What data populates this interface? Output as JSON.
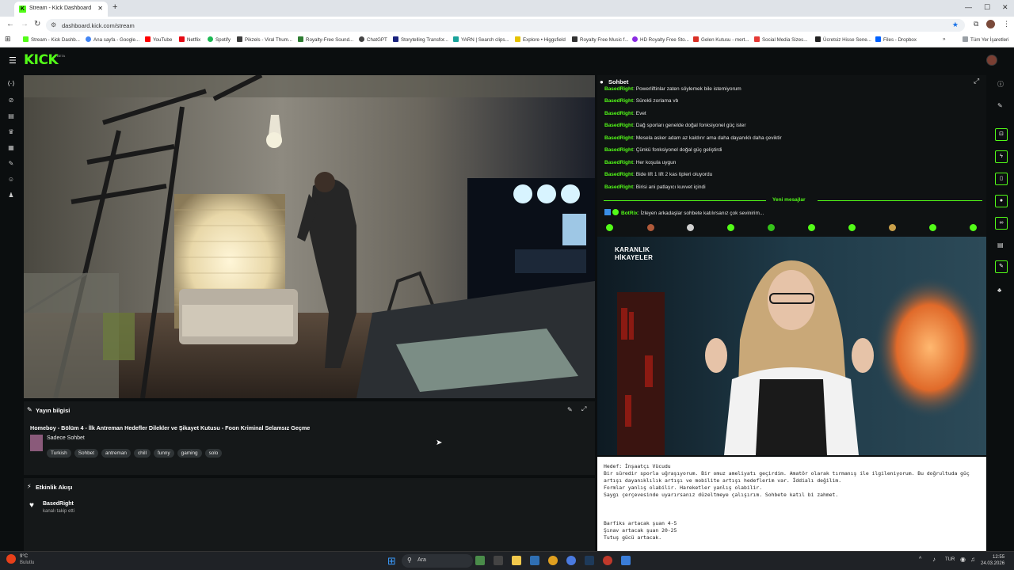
{
  "browser": {
    "tab_title": "Stream - Kick Dashboard",
    "url": "dashboard.kick.com/stream",
    "bookmarks": [
      "Stream - Kick Dashb...",
      "Ana sayfa - Google...",
      "YouTube",
      "Netflix",
      "Spotify",
      "Pikzels - Viral Thum...",
      "Royalty-Free Sound...",
      "ChatGPT",
      "Storytelling Transfor...",
      "YARN | Search clips...",
      "Explore • Higgsfield",
      "Royalty Free Music f...",
      "HD Royalty Free Sto...",
      "Gelen Kutusu - mert...",
      "Social Media Sizes...",
      "Ücretsiz Hisse Sene...",
      "Files - Dropbox"
    ],
    "all_bookmarks": "Tüm Yer İşaretleri",
    "bookmark_colors": [
      "#53fc18",
      "#4285f4",
      "#ff0000",
      "#e50914",
      "#1db954",
      "#3c3c3c",
      "#2e7d32",
      "#444444",
      "#1a237e",
      "#1aa39b",
      "#e6c200",
      "#333333",
      "#8a2be2",
      "#d93025",
      "#e53935",
      "#222222",
      "#0061ff"
    ]
  },
  "kick": {
    "logo": "KICK",
    "beta": "BETA"
  },
  "stream_info": {
    "header": "Yayın bilgisi",
    "title": "Homeboy - Bölüm 4 - İlk Antreman Hedefler Dilekler ve Şikayet Kutusu - Foon Kriminal Selamsız Geçme",
    "category": "Sadece Sohbet",
    "tags": [
      "Turkish",
      "Sohbet",
      "antreman",
      "chill",
      "funny",
      "gaming",
      "solo"
    ]
  },
  "activity": {
    "header": "Etkinlik Akışı",
    "user": "BasedRight",
    "event": "kanalı takip etti"
  },
  "chat": {
    "header": "Sohbet",
    "messages": [
      {
        "user": "BasedRight",
        "text": ": Powerliftinlar zaten söylemek bile istemiyorum"
      },
      {
        "user": "BasedRight",
        "text": ": Sürekli zorlama vb"
      },
      {
        "user": "BasedRight",
        "text": ": Evet"
      },
      {
        "user": "BasedRight",
        "text": ": Dağ sporları genelde doğal fonksiyonel güç ister"
      },
      {
        "user": "BasedRight",
        "text": ": Mesela asker adam az kaldırır ama daha dayanıklı daha çeviktir"
      },
      {
        "user": "BasedRight",
        "text": ": Çünkü fonksiyonel doğal güç geliştirdi"
      },
      {
        "user": "BasedRight",
        "text": ": Her koşula uygun"
      },
      {
        "user": "BasedRight",
        "text": ": Bide lift 1 lift 2 kas tipleri oluyordu"
      },
      {
        "user": "BasedRight",
        "text": ": Birisi ani patlayıcı kuvvet içindi"
      }
    ],
    "new_messages": "Yeni mesajlar",
    "bot_user": "BotRix",
    "bot_text": ": İzleyen arkadaşlar sohbete katılırsanız çok sevinirim..."
  },
  "overlay": {
    "title_line1": "KARANLIK",
    "title_line2": "HİKAYELER"
  },
  "notepad": {
    "lines": [
      "Hedef: İnşaatçı Vücudu",
      "Bir süredir sporla uğraşıyorum. Bir omuz ameliyatı geçirdim. Amatör olarak tırmanış ile ilgileniyorum. Bu doğrultuda güç",
      "artışı dayanıklılık artışı ve mobilite artışı hedeflerim var. İddialı değilim.",
      "Formlar yanlış olabilir. Hareketler yanlış olabilir.",
      "Saygı çerçevesinde uyarırsanız düzeltmeye çalışırım. Sohbete katıl bi zahmet.",
      "Barfiks artacak şuan 4-5",
      "Şınav artacak  şuan 20-25",
      "Tutuş gücü artacak."
    ]
  },
  "taskbar": {
    "weather_temp": "9°C",
    "weather_text": "Bulutlu",
    "search_placeholder": "Ara",
    "lang": "TUR",
    "time": "12:55",
    "date": "24.03.2026"
  }
}
